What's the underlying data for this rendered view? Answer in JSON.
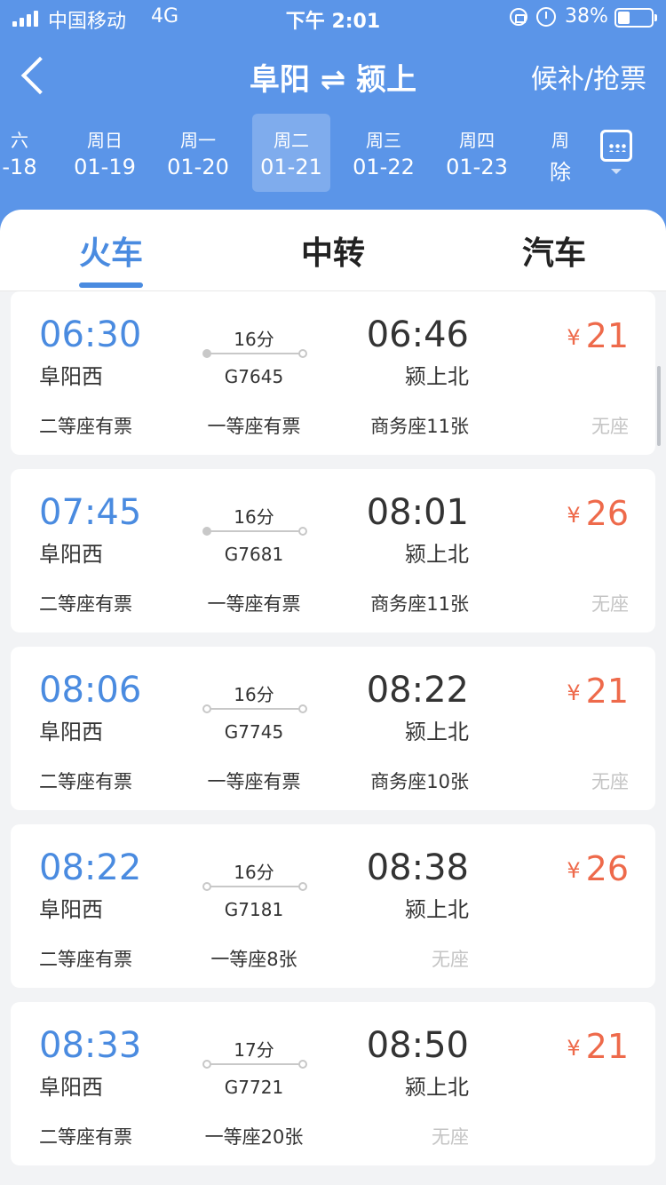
{
  "status_bar": {
    "carrier": "中国移动",
    "network": "4G",
    "time": "下午 2:01",
    "battery": "38%"
  },
  "nav": {
    "title": "阜阳 ⇌ 颍上",
    "right_action": "候补/抢票"
  },
  "dates": [
    {
      "weekday": "六",
      "date": "-18"
    },
    {
      "weekday": "周日",
      "date": "01-19"
    },
    {
      "weekday": "周一",
      "date": "01-20"
    },
    {
      "weekday": "周二",
      "date": "01-21",
      "selected": true
    },
    {
      "weekday": "周三",
      "date": "01-22"
    },
    {
      "weekday": "周四",
      "date": "01-23"
    },
    {
      "weekday": "周",
      "date": "除"
    }
  ],
  "tabs": [
    "火车",
    "中转",
    "汽车"
  ],
  "active_tab": "火车",
  "colors": {
    "header_bg": "#5b95e8",
    "accent": "#4a8be0",
    "price": "#ee6a4b"
  },
  "trains": [
    {
      "dep_time": "06:30",
      "dep_station": "阜阳西",
      "duration": "16分",
      "train_no": "G7645",
      "arr_time": "06:46",
      "arr_station": "颍上北",
      "currency": "¥",
      "price": "21",
      "seats": [
        "二等座有票",
        "一等座有票",
        "商务座11张",
        "无座"
      ]
    },
    {
      "dep_time": "07:45",
      "dep_station": "阜阳西",
      "duration": "16分",
      "train_no": "G7681",
      "arr_time": "08:01",
      "arr_station": "颍上北",
      "currency": "¥",
      "price": "26",
      "seats": [
        "二等座有票",
        "一等座有票",
        "商务座11张",
        "无座"
      ]
    },
    {
      "dep_time": "08:06",
      "dep_station": "阜阳西",
      "duration": "16分",
      "train_no": "G7745",
      "arr_time": "08:22",
      "arr_station": "颍上北",
      "currency": "¥",
      "price": "21",
      "seats": [
        "二等座有票",
        "一等座有票",
        "商务座10张",
        "无座"
      ]
    },
    {
      "dep_time": "08:22",
      "dep_station": "阜阳西",
      "duration": "16分",
      "train_no": "G7181",
      "arr_time": "08:38",
      "arr_station": "颍上北",
      "currency": "¥",
      "price": "26",
      "seats": [
        "二等座有票",
        "一等座8张",
        "无座"
      ]
    },
    {
      "dep_time": "08:33",
      "dep_station": "阜阳西",
      "duration": "17分",
      "train_no": "G7721",
      "arr_time": "08:50",
      "arr_station": "颍上北",
      "currency": "¥",
      "price": "21",
      "seats": [
        "二等座有票",
        "一等座20张",
        "无座"
      ]
    }
  ]
}
